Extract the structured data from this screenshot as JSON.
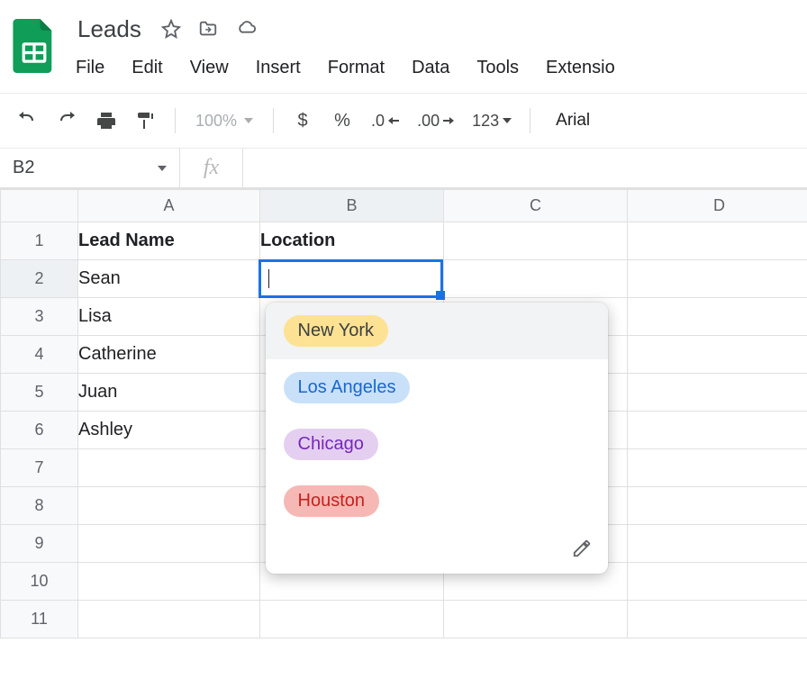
{
  "doc": {
    "title": "Leads"
  },
  "menu": {
    "items": [
      "File",
      "Edit",
      "View",
      "Insert",
      "Format",
      "Data",
      "Tools",
      "Extensio"
    ]
  },
  "toolbar": {
    "zoom": "100%",
    "currency": "$",
    "percent": "%",
    "dec_decrease": ".0",
    "dec_increase": ".00",
    "numformat": "123",
    "font": "Arial"
  },
  "namebox": {
    "ref": "B2"
  },
  "formula": {
    "fx_label": "fx",
    "value": ""
  },
  "columns": [
    "A",
    "B",
    "C",
    "D"
  ],
  "active_column_index": 1,
  "rows": [
    1,
    2,
    3,
    4,
    5,
    6,
    7,
    8,
    9,
    10,
    11
  ],
  "active_row_index": 1,
  "headers": {
    "A": "Lead Name",
    "B": "Location"
  },
  "data": {
    "A": [
      "Sean",
      "Lisa",
      "Catherine",
      "Juan",
      "Ashley"
    ]
  },
  "active_cell": {
    "col": "B",
    "row": 2
  },
  "dropdown": {
    "highlighted_index": 0,
    "options": [
      {
        "label": "New York",
        "bg": "#fde293",
        "fg": "#3c4043"
      },
      {
        "label": "Los Angeles",
        "bg": "#c8e1f9",
        "fg": "#1967d2"
      },
      {
        "label": "Chicago",
        "bg": "#e4cff0",
        "fg": "#7627bb"
      },
      {
        "label": "Houston",
        "bg": "#f6b8b4",
        "fg": "#c5221f"
      }
    ]
  }
}
